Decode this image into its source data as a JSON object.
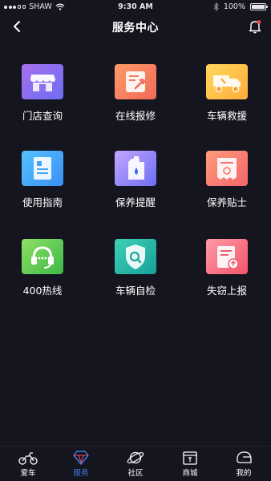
{
  "status_bar": {
    "carrier": "SHAW",
    "time": "9:30 AM",
    "battery": "100%"
  },
  "nav": {
    "title": "服务中心"
  },
  "services": [
    {
      "label": "门店查询",
      "icon": "store-icon",
      "color_from": "#a76ff0",
      "color_to": "#6d6df2"
    },
    {
      "label": "在线报修",
      "icon": "repair-icon",
      "color_from": "#ff9a6a",
      "color_to": "#f06a56"
    },
    {
      "label": "车辆救援",
      "icon": "tow-truck-icon",
      "color_from": "#ffd75a",
      "color_to": "#ffad3c"
    },
    {
      "label": "使用指南",
      "icon": "guide-icon",
      "color_from": "#55c2ff",
      "color_to": "#3a8ff5"
    },
    {
      "label": "保养提醒",
      "icon": "oil-can-icon",
      "color_from": "#c4a5ff",
      "color_to": "#6c6ff2"
    },
    {
      "label": "保养贴士",
      "icon": "tips-icon",
      "color_from": "#ff9d7a",
      "color_to": "#f3646a"
    },
    {
      "label": "400热线",
      "icon": "headset-icon",
      "color_from": "#8ee064",
      "color_to": "#3db848"
    },
    {
      "label": "车辆自检",
      "icon": "shield-search-icon",
      "color_from": "#3fd0b6",
      "color_to": "#17a09a"
    },
    {
      "label": "失窃上报",
      "icon": "report-icon",
      "color_from": "#ff9aa6",
      "color_to": "#f2546c"
    }
  ],
  "tabs": [
    {
      "label": "爱车",
      "icon": "motorcycle-icon",
      "active": false
    },
    {
      "label": "服务",
      "icon": "diamond-icon",
      "active": true
    },
    {
      "label": "社区",
      "icon": "planet-icon",
      "active": false
    },
    {
      "label": "商城",
      "icon": "shop-icon",
      "active": false
    },
    {
      "label": "我的",
      "icon": "helmet-icon",
      "active": false
    }
  ],
  "colors": {
    "background": "#15151f",
    "active_tab": "#3e7de6",
    "notification_dot": "#f0473c"
  }
}
